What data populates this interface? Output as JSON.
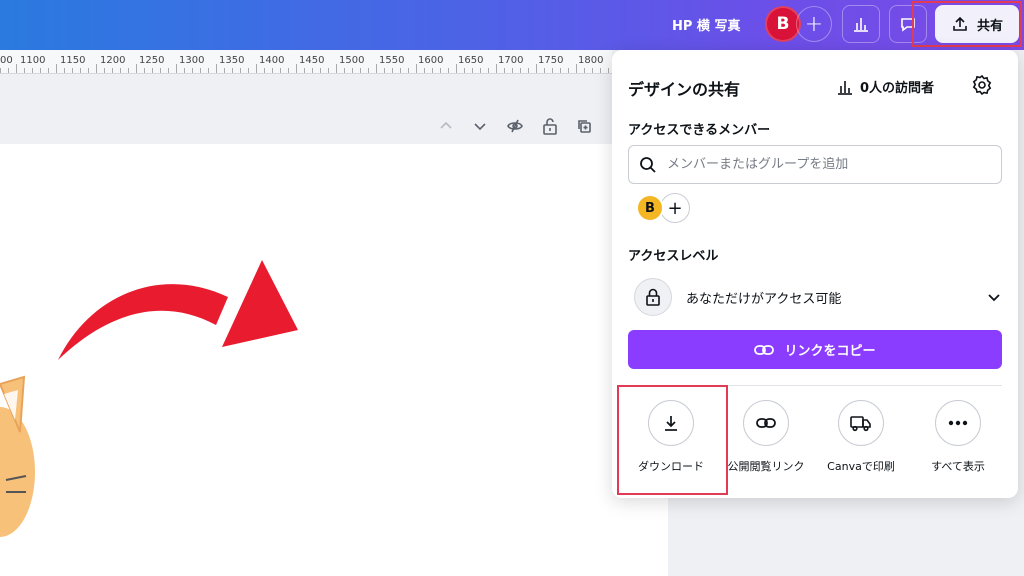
{
  "topbar": {
    "design_title": "HP 横 写真",
    "user_initial": "B",
    "share_label": "共有"
  },
  "ruler": {
    "ticks": [
      "00",
      "1100",
      "1150",
      "1200",
      "1250",
      "1300",
      "1350",
      "1400",
      "1450",
      "1500",
      "1550",
      "1600",
      "1650",
      "1700",
      "1750",
      "1800"
    ]
  },
  "share_panel": {
    "title": "デザインの共有",
    "visitors": "0人の訪問者",
    "members_label": "アクセスできるメンバー",
    "search_placeholder": "メンバーまたはグループを追加",
    "member_initial": "B",
    "access_level_label": "アクセスレベル",
    "access_level_value": "あなただけがアクセス可能",
    "copy_link_label": "リンクをコピー",
    "actions": [
      {
        "label": "ダウンロード",
        "icon": "download-icon"
      },
      {
        "label": "公開閲覧リンク",
        "icon": "link-icon"
      },
      {
        "label": "Canvaで印刷",
        "icon": "truck-icon"
      },
      {
        "label": "すべて表示",
        "icon": "more-icon"
      }
    ]
  },
  "colors": {
    "accent_purple": "#8b3dff",
    "avatar_red": "#d9123a",
    "member_yellow": "#f5b623",
    "highlight_red": "#e23b55",
    "arrow_red": "#e81c2e"
  }
}
